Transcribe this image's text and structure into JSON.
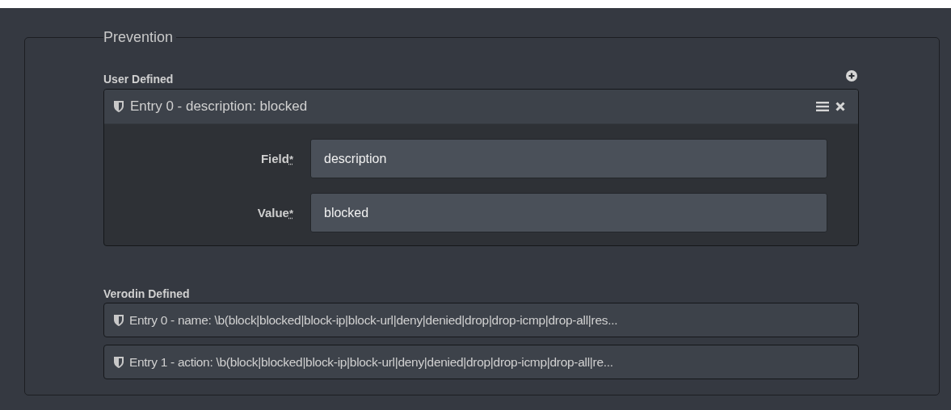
{
  "section": {
    "legend": "Prevention"
  },
  "user_defined": {
    "heading": "User Defined",
    "entries": [
      {
        "title": "Entry 0 - description: blocked",
        "expanded": true,
        "fields": [
          {
            "label": "Field",
            "required_mark": "*",
            "value": "description"
          },
          {
            "label": "Value",
            "required_mark": "*",
            "value": "blocked"
          }
        ]
      }
    ]
  },
  "verodin_defined": {
    "heading": "Verodin Defined",
    "entries": [
      {
        "title": "Entry 0 - name: \\b(block|blocked|block-ip|block-url|deny|denied|drop|drop-icmp|drop-all|res..."
      },
      {
        "title": "Entry 1 - action: \\b(block|blocked|block-ip|block-url|deny|denied|drop|drop-icmp|drop-all|re..."
      }
    ]
  }
}
